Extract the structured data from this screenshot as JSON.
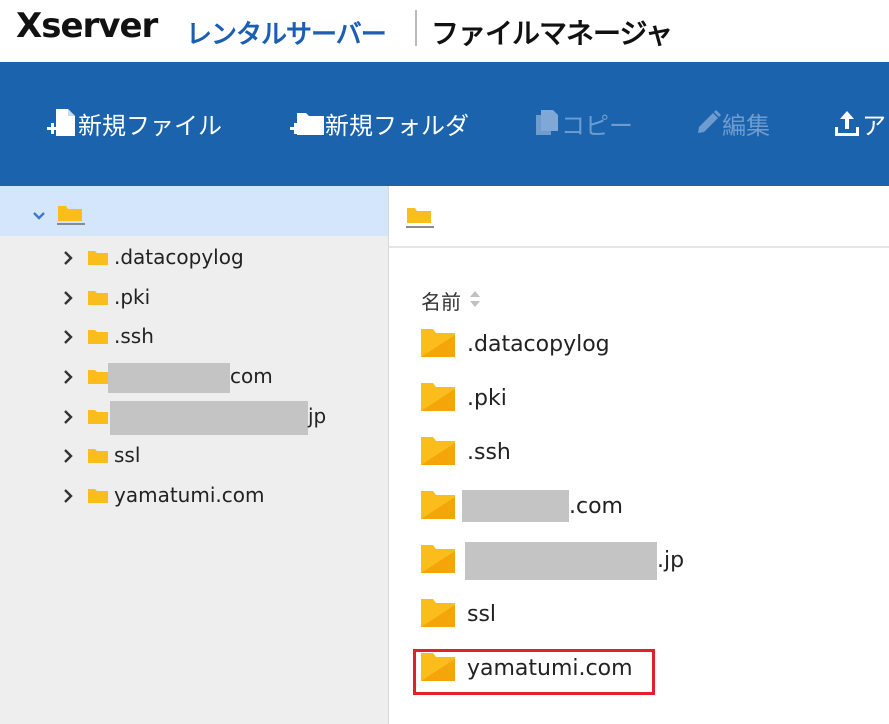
{
  "header": {
    "logo": "Xserver",
    "product": "レンタルサーバー",
    "app_title": "ファイルマネージャ"
  },
  "toolbar": {
    "new_file": "新規ファイル",
    "new_folder": "新規フォルダ",
    "copy": "コピー",
    "edit": "編集",
    "upload": "ア"
  },
  "sidebar": {
    "items": [
      {
        "name": ".datacopylog"
      },
      {
        "name": ".pki"
      },
      {
        "name": ".ssh"
      },
      {
        "name": "com"
      },
      {
        "name": "jp"
      },
      {
        "name": "ssl"
      },
      {
        "name": "yamatumi.com"
      }
    ]
  },
  "main": {
    "column_name": "名前",
    "files": [
      {
        "name": ".datacopylog"
      },
      {
        "name": ".pki"
      },
      {
        "name": ".ssh"
      },
      {
        "name": ".com"
      },
      {
        "name": ".jp"
      },
      {
        "name": "ssl"
      },
      {
        "name": "yamatumi.com"
      }
    ]
  },
  "colors": {
    "toolbar": "#1c63ad",
    "folder": "#fbbd1b",
    "folder_dark": "#f5a50a",
    "selection": "#d4e6fb",
    "highlight": "#e0202a"
  }
}
